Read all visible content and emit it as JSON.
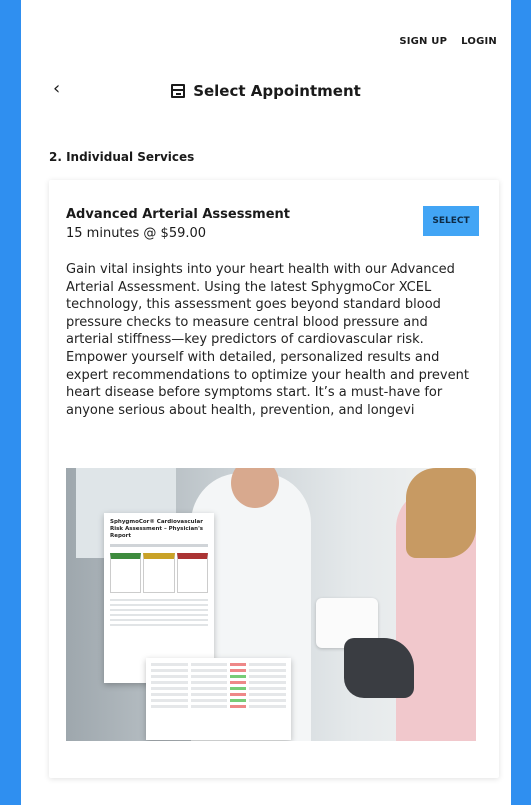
{
  "nav": {
    "sign_up": "SIGN UP",
    "login": "LOGIN"
  },
  "header": {
    "title": "Select Appointment",
    "back_icon": "chevron-left-icon",
    "title_icon": "calendar-icon"
  },
  "section": {
    "label": "2. Individual Services"
  },
  "service": {
    "name": "Advanced Arterial Assessment",
    "meta": "15 minutes @ $59.00",
    "select_label": "SELECT",
    "description": "Gain vital insights into your heart health with our Advanced Arterial Assessment. Using the latest SphygmoCor XCEL technology, this assessment goes beyond standard blood pressure checks to measure central blood pressure and arterial stiffness—key predictors of cardiovascular risk. Empower yourself with detailed, personalized results and expert recommendations to optimize your health and prevent heart disease before symptoms start. It’s a must-have for anyone serious about health, prevention, and longevi",
    "image_report_title": "SphygmoCor® Cardiovascular Risk Assessment – Physician's Report"
  },
  "colors": {
    "background": "#2f8ff0",
    "select_button": "#42a5f5"
  }
}
